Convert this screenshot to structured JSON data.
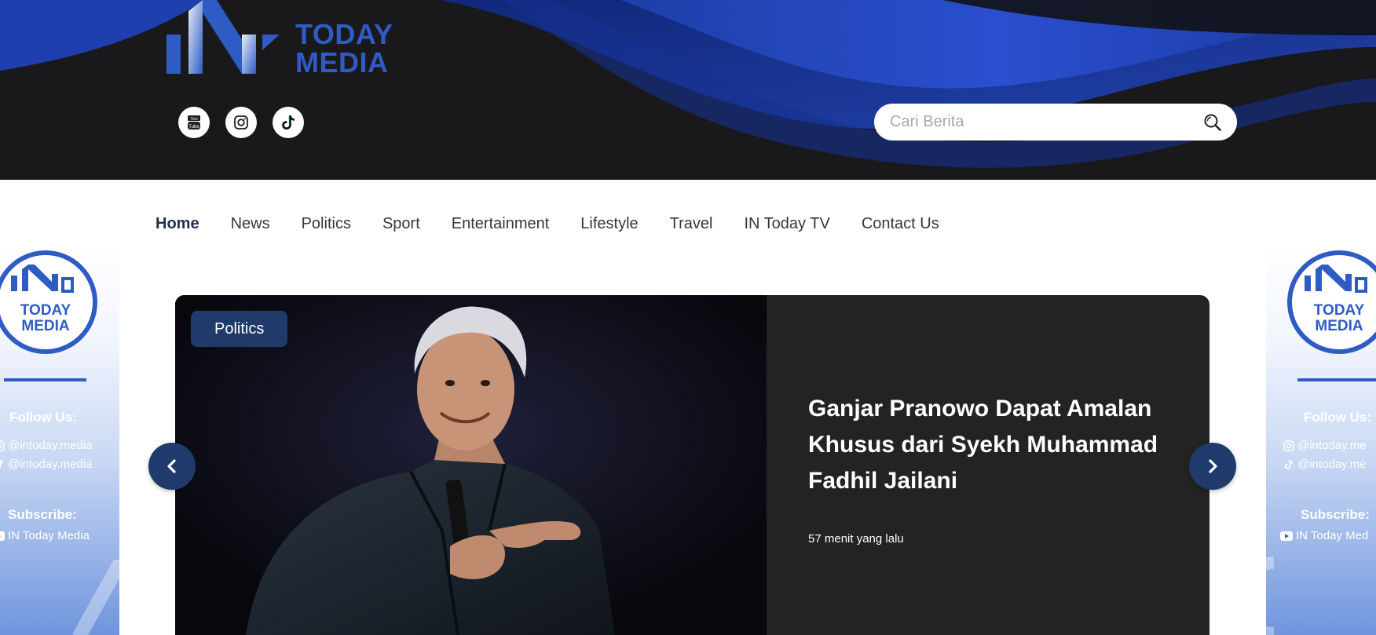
{
  "header": {
    "logo_line1": "TODAY",
    "logo_line2": "MEDIA",
    "brand_color": "#2f5bc4",
    "social": [
      {
        "name": "youtube-icon"
      },
      {
        "name": "instagram-icon"
      },
      {
        "name": "tiktok-icon"
      }
    ],
    "search_placeholder": "Cari Berita"
  },
  "nav": {
    "items": [
      {
        "label": "Home",
        "active": true
      },
      {
        "label": "News"
      },
      {
        "label": "Politics"
      },
      {
        "label": "Sport"
      },
      {
        "label": "Entertainment"
      },
      {
        "label": "Lifestyle"
      },
      {
        "label": "Travel"
      },
      {
        "label": "IN Today TV"
      },
      {
        "label": "Contact Us"
      }
    ]
  },
  "side_banner": {
    "logo_line1": "TODAY",
    "logo_line2": "MEDIA",
    "follow_heading": "Follow Us:",
    "instagram_handle": "@intoday.media",
    "tiktok_handle": "@intoday.media",
    "subscribe_heading": "Subscribe:",
    "youtube_channel": "IN Today Media",
    "right_instagram_handle": "@intoday.me",
    "right_tiktok_handle": "@intoday.me",
    "right_youtube_channel": "IN Today Med"
  },
  "slider": {
    "category": "Politics",
    "title": "Ganjar Pranowo Dapat Amalan Khusus dari Syekh Muhammad Fadhil Jailani",
    "time": "57 menit yang lalu",
    "accent_color": "#1f3a6b"
  }
}
